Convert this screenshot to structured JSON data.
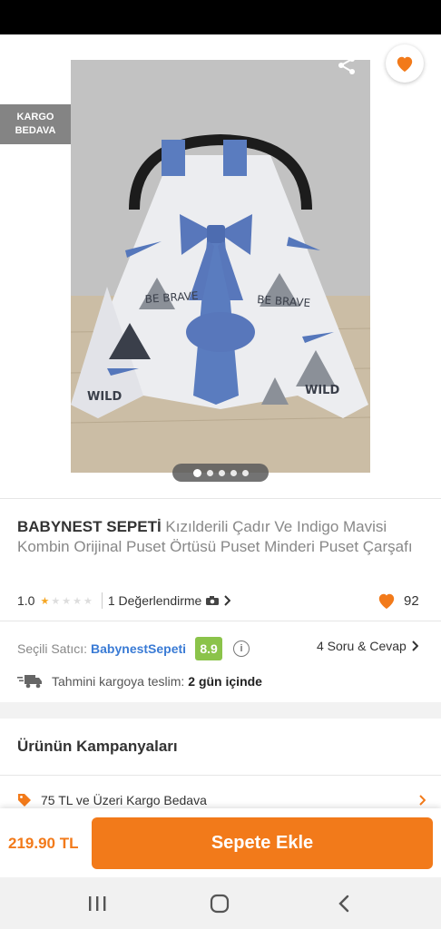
{
  "header": {
    "cargo_badge_line1": "KARGO",
    "cargo_badge_line2": "BEDAVA",
    "icons": [
      "back-arrow-icon",
      "share-icon",
      "heart-icon"
    ],
    "gallery": {
      "count": 5,
      "active": 0
    }
  },
  "product": {
    "brand": "BABYNEST SEPETİ",
    "name": " Kızılderili Çadır Ve Indigo Mavisi Kombin Orijinal Puset Örtüsü  Puset Minderi Puset Çarşafı",
    "rating": "1.0",
    "stars_filled": 1,
    "stars_total": 5,
    "reviews_label": "1 Değerlendirme",
    "likes": "92",
    "image_text_left": "BE BRAVE",
    "image_text_right": "BE BRAVE",
    "image_text_wild_left": "WILD",
    "image_text_wild_right": "WILD"
  },
  "seller": {
    "label": "Seçili Satıcı:",
    "name": "BabynestSepeti",
    "score": "8.9",
    "qa_label": "4 Soru & Cevap"
  },
  "delivery": {
    "label": "Tahmini kargoya teslim:",
    "value": "2 gün içinde"
  },
  "campaigns": {
    "title": "Ürünün Kampanyaları",
    "items": [
      {
        "label": "75 TL ve Üzeri Kargo Bedava"
      }
    ]
  },
  "cart": {
    "price": "219.90 TL",
    "button_label": "Sepete Ekle"
  },
  "colors": {
    "accent": "#f27a1a",
    "seller_link": "#3a7bd5",
    "score_badge": "#8bc34a",
    "star": "#f5a623"
  }
}
